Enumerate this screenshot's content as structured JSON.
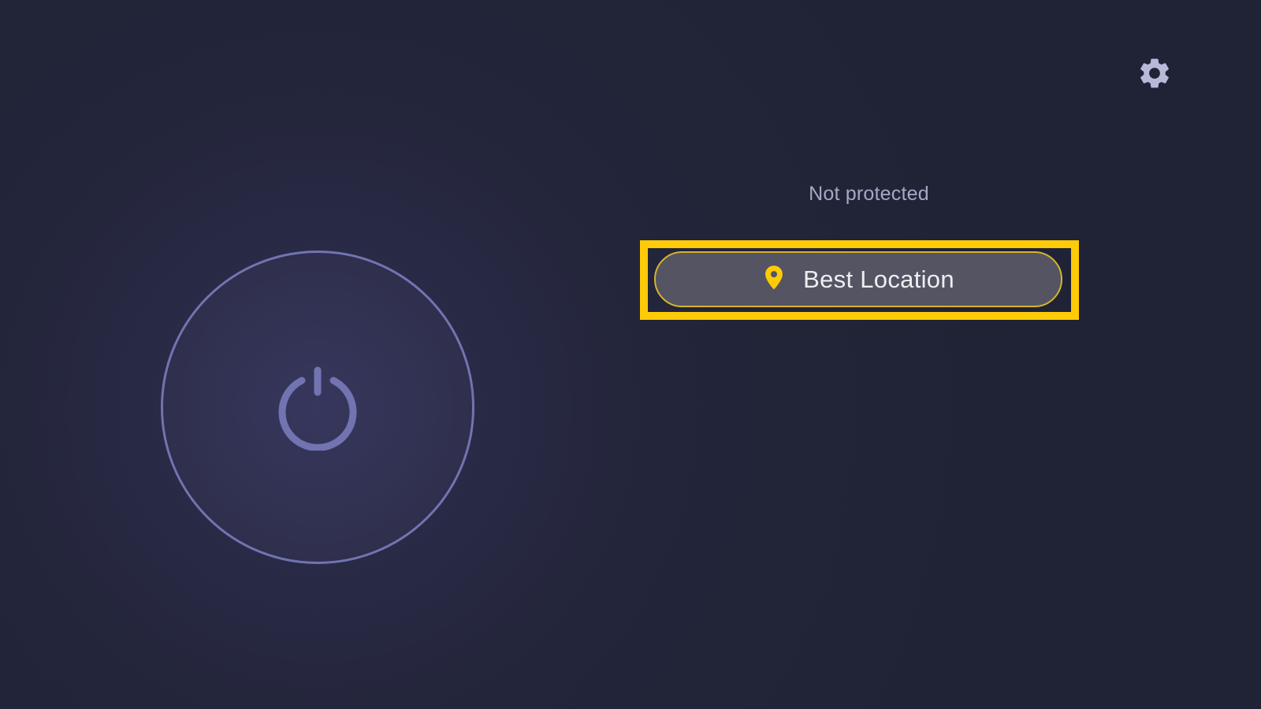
{
  "status": {
    "text": "Not protected"
  },
  "location": {
    "label": "Best Location",
    "icon": "location-pin-icon"
  },
  "toolbar": {
    "settings_icon": "gear-icon"
  },
  "power": {
    "icon": "power-icon",
    "state": "disconnected"
  },
  "colors": {
    "background": "#23253a",
    "accent_yellow": "#fdcb07",
    "power_ring": "#7174b0",
    "status_text": "#a5a8c4",
    "gear": "#b8b8d8",
    "pill_background": "#545463"
  }
}
